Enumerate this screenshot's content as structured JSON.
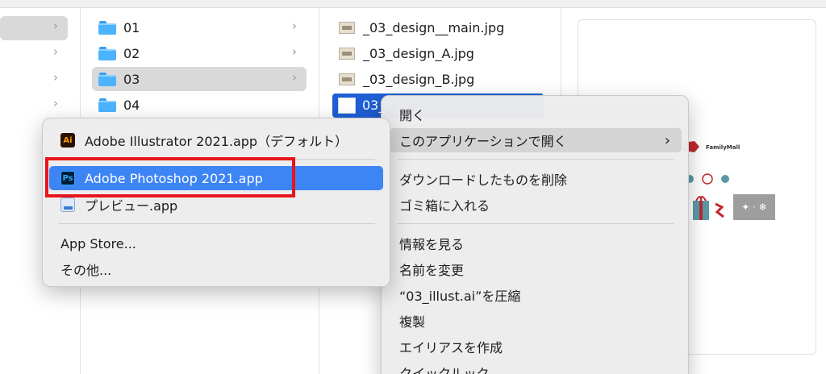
{
  "finder": {
    "col1": [
      {
        "label": "01"
      },
      {
        "label": "02"
      },
      {
        "label": "03"
      },
      {
        "label": "04"
      }
    ],
    "col2": [
      {
        "label": "_03_design__main.jpg"
      },
      {
        "label": "_03_design_A.jpg"
      },
      {
        "label": "_03_design_B.jpg"
      },
      {
        "label": "03_"
      }
    ],
    "preview": {
      "logo_text": "FamilyMall",
      "snow_text": "✦ · ❄"
    }
  },
  "context_menu": {
    "items": [
      {
        "label": "開く"
      },
      {
        "label": "このアプリケーションで開く"
      },
      {
        "label": "ダウンロードしたものを削除"
      },
      {
        "label": "ゴミ箱に入れる"
      },
      {
        "label": "情報を見る"
      },
      {
        "label": "名前を変更"
      },
      {
        "label": "“03_illust.ai”を圧縮"
      },
      {
        "label": "複製"
      },
      {
        "label": "エイリアスを作成"
      },
      {
        "label": "クイックルック"
      }
    ]
  },
  "open_with_menu": {
    "items": [
      {
        "label": "Adobe Illustrator 2021.app（デフォルト）",
        "icon": "Ai"
      },
      {
        "label": "Adobe Photoshop 2021.app",
        "icon": "Ps"
      },
      {
        "label": "プレビュー.app",
        "icon": "preview"
      },
      {
        "label": "App Store..."
      },
      {
        "label": "その他..."
      }
    ]
  },
  "colors": {
    "selection_blue": "#3d84f5",
    "highlight_red": "#e8141b",
    "folder_blue": "#4cb3ff"
  }
}
